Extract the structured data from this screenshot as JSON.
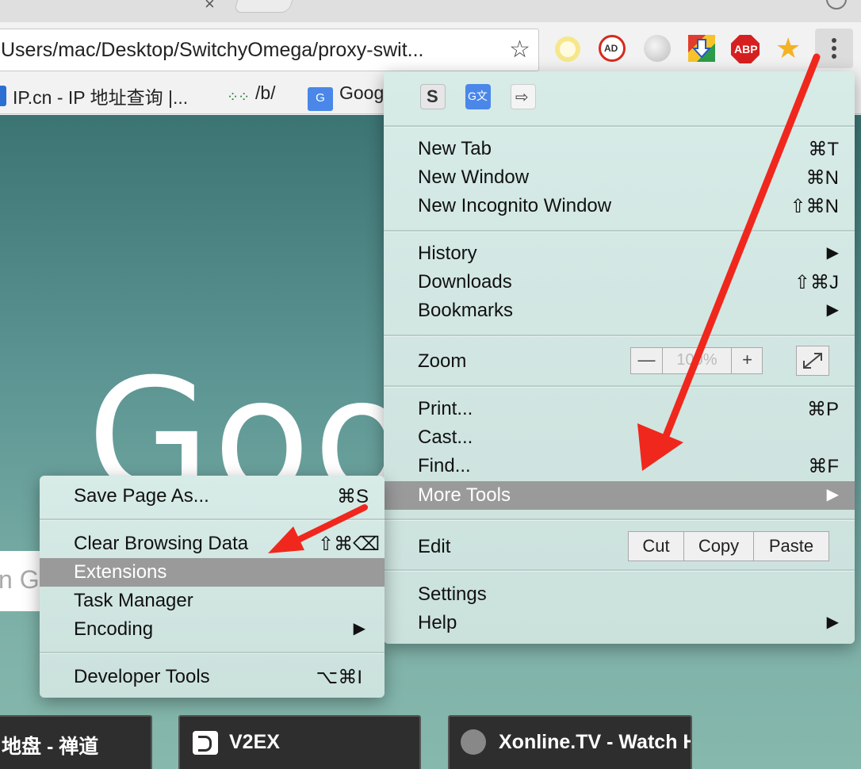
{
  "toolbar": {
    "url": "Users/mac/Desktop/SwitchyOmega/proxy-swit...",
    "adblock_plus_badge": "AD",
    "abp_label": "ABP"
  },
  "bookmarks": [
    {
      "label": "IP.cn - IP 地址查询 |..."
    },
    {
      "label": "/b/"
    },
    {
      "label": "Goog"
    }
  ],
  "menu_extensions": {
    "s_label": "S",
    "translate_label": "G文",
    "arrow_label": "⇨"
  },
  "main_menu": {
    "new_tab": {
      "label": "New Tab",
      "shortcut": "⌘T"
    },
    "new_window": {
      "label": "New Window",
      "shortcut": "⌘N"
    },
    "new_incognito": {
      "label": "New Incognito Window",
      "shortcut": "⇧⌘N"
    },
    "history": {
      "label": "History",
      "shortcut": "▶"
    },
    "downloads": {
      "label": "Downloads",
      "shortcut": "⇧⌘J"
    },
    "bookmarks": {
      "label": "Bookmarks",
      "shortcut": "▶"
    },
    "zoom": {
      "label": "Zoom",
      "minus": "—",
      "level": "100%",
      "plus": "+",
      "fullscreen": "⤢"
    },
    "print": {
      "label": "Print...",
      "shortcut": "⌘P"
    },
    "cast": {
      "label": "Cast..."
    },
    "find": {
      "label": "Find...",
      "shortcut": "⌘F"
    },
    "more_tools": {
      "label": "More Tools",
      "shortcut": "▶"
    },
    "edit": {
      "label": "Edit",
      "cut": "Cut",
      "copy": "Copy",
      "paste": "Paste"
    },
    "settings": {
      "label": "Settings"
    },
    "help": {
      "label": "Help",
      "shortcut": "▶"
    }
  },
  "sub_menu": {
    "save_page": {
      "label": "Save Page As...",
      "shortcut": "⌘S"
    },
    "clear_data": {
      "label": "Clear Browsing Data",
      "shortcut": "⇧⌘⌫"
    },
    "extensions": {
      "label": "Extensions"
    },
    "task_manager": {
      "label": "Task Manager"
    },
    "encoding": {
      "label": "Encoding",
      "shortcut": "▶"
    },
    "dev_tools": {
      "label": "Developer Tools",
      "shortcut": "⌥⌘I"
    }
  },
  "page": {
    "logo": "Goog",
    "search_placeholder": "n Go",
    "tiles": [
      {
        "title": "地盘 - 禅道"
      },
      {
        "title": "V2EX"
      },
      {
        "title": "Xonline.TV - Watch HD"
      }
    ]
  },
  "colors": {
    "highlight": "#9a9a9a",
    "annotation_arrow": "#f0271d",
    "page_bg_top": "#3c7473"
  }
}
